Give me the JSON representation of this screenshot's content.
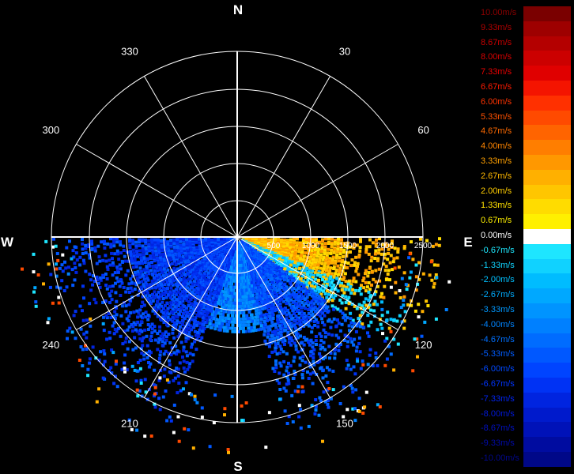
{
  "compass": {
    "north": "N",
    "east": "E",
    "south": "S",
    "west": "W"
  },
  "bearings": [
    {
      "deg": 30,
      "label": "30"
    },
    {
      "deg": 60,
      "label": "60"
    },
    {
      "deg": 120,
      "label": "120"
    },
    {
      "deg": 150,
      "label": "150"
    },
    {
      "deg": 210,
      "label": "210"
    },
    {
      "deg": 240,
      "label": "240"
    },
    {
      "deg": 300,
      "label": "300"
    },
    {
      "deg": 330,
      "label": "330"
    }
  ],
  "range_rings": [
    "500",
    "1000",
    "1500",
    "2000",
    "2500"
  ],
  "legend": [
    {
      "label": "10.00m/s",
      "text_color": "#8b0000",
      "color": "#7a0000"
    },
    {
      "label": "9.33m/s",
      "text_color": "#b00000",
      "color": "#9e0000"
    },
    {
      "label": "8.67m/s",
      "text_color": "#c80000",
      "color": "#b40000"
    },
    {
      "label": "8.00m/s",
      "text_color": "#d80000",
      "color": "#cc0000"
    },
    {
      "label": "7.33m/s",
      "text_color": "#e80000",
      "color": "#e00000"
    },
    {
      "label": "6.67m/s",
      "text_color": "#ff1a00",
      "color": "#f41400"
    },
    {
      "label": "6.00m/s",
      "text_color": "#ff3300",
      "color": "#ff3000"
    },
    {
      "label": "5.33m/s",
      "text_color": "#ff5000",
      "color": "#ff4a00"
    },
    {
      "label": "4.67m/s",
      "text_color": "#ff6a00",
      "color": "#ff6400"
    },
    {
      "label": "4.00m/s",
      "text_color": "#ff8500",
      "color": "#ff7e00"
    },
    {
      "label": "3.33m/s",
      "text_color": "#ffa000",
      "color": "#ff9800"
    },
    {
      "label": "2.67m/s",
      "text_color": "#ffb800",
      "color": "#ffb000"
    },
    {
      "label": "2.00m/s",
      "text_color": "#ffcc00",
      "color": "#ffc600"
    },
    {
      "label": "1.33m/s",
      "text_color": "#ffe000",
      "color": "#ffdc00"
    },
    {
      "label": "0.67m/s",
      "text_color": "#fff000",
      "color": "#fff000"
    },
    {
      "label": "0.00m/s",
      "text_color": "#ffffff",
      "color": "#ffffff"
    },
    {
      "label": "-0.67m/s",
      "text_color": "#1ee8ff",
      "color": "#1ee6ff"
    },
    {
      "label": "-1.33m/s",
      "text_color": "#10d4ff",
      "color": "#10d2ff"
    },
    {
      "label": "-2.00m/s",
      "text_color": "#00c0ff",
      "color": "#00bcff"
    },
    {
      "label": "-2.67m/s",
      "text_color": "#00acff",
      "color": "#00a8ff"
    },
    {
      "label": "-3.33m/s",
      "text_color": "#0098ff",
      "color": "#0094ff"
    },
    {
      "label": "-4.00m/s",
      "text_color": "#0084ff",
      "color": "#0080ff"
    },
    {
      "label": "-4.67m/s",
      "text_color": "#0070ff",
      "color": "#006cff"
    },
    {
      "label": "-5.33m/s",
      "text_color": "#005cff",
      "color": "#0058ff"
    },
    {
      "label": "-6.00m/s",
      "text_color": "#0048ff",
      "color": "#0044ff"
    },
    {
      "label": "-6.67m/s",
      "text_color": "#0034ff",
      "color": "#0032f4"
    },
    {
      "label": "-7.33m/s",
      "text_color": "#0024f0",
      "color": "#0024e0"
    },
    {
      "label": "-8.00m/s",
      "text_color": "#0018d8",
      "color": "#001acc"
    },
    {
      "label": "-8.67m/s",
      "text_color": "#0010c0",
      "color": "#0012b8"
    },
    {
      "label": "-9.33m/s",
      "text_color": "#000aa8",
      "color": "#000ca0"
    },
    {
      "label": "-10.00m/s",
      "text_color": "#00078c",
      "color": "#000888"
    }
  ],
  "colors": {
    "background": "#000000",
    "grid": "#ffffff"
  }
}
